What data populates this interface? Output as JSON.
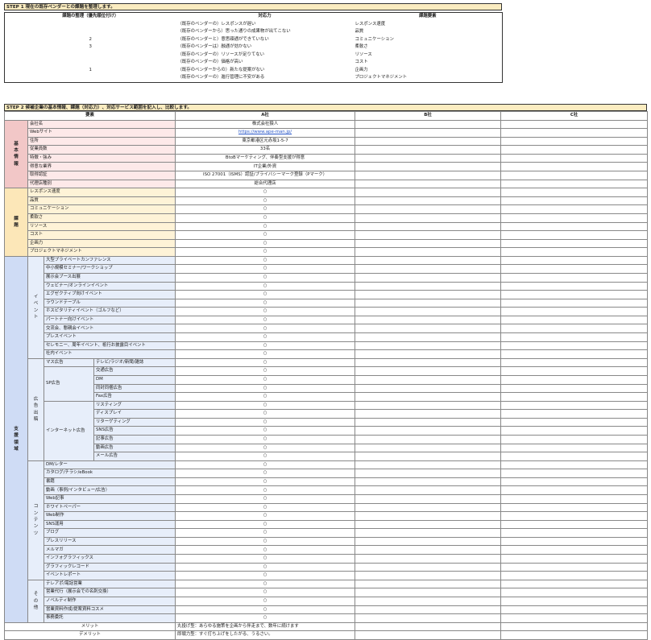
{
  "step1": {
    "title": "STEP 1  現在の既存ベンダーとの課題を整理します。",
    "headers": [
      "課題の整理（優先順位付け）",
      "対応力",
      "課題要素"
    ],
    "rows": [
      {
        "priority": "",
        "issue": "（既存のベンダーの）レスポンスが遅い",
        "element": "レスポンス速度"
      },
      {
        "priority": "",
        "issue": "（既存のベンダーから）思った通りの成果物が出てこない",
        "element": "品質"
      },
      {
        "priority": "2",
        "issue": "（既存のベンダーと）意思疎通ができていない",
        "element": "コミュニケーション"
      },
      {
        "priority": "3",
        "issue": "（既存のベンダーは）融通が効かない",
        "element": "柔軟さ"
      },
      {
        "priority": "",
        "issue": "（既存のベンダーの）リソースが足りてない",
        "element": "リソース"
      },
      {
        "priority": "",
        "issue": "（既存のベンダーの）価格が高い",
        "element": "コスト"
      },
      {
        "priority": "1",
        "issue": "（既存のベンダーからの）新たな提案がない",
        "element": "企画力"
      },
      {
        "priority": "",
        "issue": "（既存のベンダーの）進行管理に不安がある",
        "element": "プロジェクトマネジメント"
      }
    ]
  },
  "step2": {
    "title": "STEP 2  候補企業の基本情報、課題（対応力）、対応サービス範囲を記入し、比較します。",
    "headers": {
      "element": "要素",
      "a": "A社",
      "b": "B社",
      "c": "C社"
    },
    "basic": {
      "label": "基本情報",
      "rows": [
        {
          "label": "会社名",
          "a": "株式会社猿人"
        },
        {
          "label": "Webサイト",
          "a": "https://www.ape-man.jp/",
          "link": true
        },
        {
          "label": "住所",
          "a": "東京都港区元赤坂1-5-7"
        },
        {
          "label": "従業員数",
          "a": "33名"
        },
        {
          "label": "特徴・強み",
          "a": "BtoBマーケティング、伴奏型支援が得意"
        },
        {
          "label": "得意な業界",
          "a": "IT企業/外資"
        },
        {
          "label": "取得認証",
          "a": "ISO 27001（ISMS）認証/プライバシーマーク登録（Pマーク）"
        },
        {
          "label": "代理店種別",
          "a": "総合代理店"
        }
      ]
    },
    "issues": {
      "label": "課題",
      "rows": [
        {
          "label": "レスポンス速度",
          "a": "○"
        },
        {
          "label": "品質",
          "a": "○"
        },
        {
          "label": "コミュニケーション",
          "a": "○"
        },
        {
          "label": "柔軟さ",
          "a": "○"
        },
        {
          "label": "リソース",
          "a": "○"
        },
        {
          "label": "コスト",
          "a": "○"
        },
        {
          "label": "企画力",
          "a": "○"
        },
        {
          "label": "プロジェクトマネジメント",
          "a": "○"
        }
      ]
    },
    "support": {
      "label": "支援領域",
      "event": {
        "label": "イベント",
        "rows": [
          "大型プライベートカンファレンス",
          "中小規模セミナー/ワークショップ",
          "展示会ブース出展",
          "ウェビナー/オンラインイベント",
          "エグゼクティブ向けイベント",
          "ラウンドテーブル",
          "ホスピタリティイベント（ゴルフなど）",
          "パートナー向けイベント",
          "交流会、懇親会イベント",
          "プレスイベント",
          "セレモニー、周年イベント、祇行お披露目イベント",
          "社内イベント"
        ]
      },
      "ads": {
        "label": "広告出稿",
        "mass": {
          "label": "マス広告",
          "sub": "テレビ/ラジオ/新聞/雑誌"
        },
        "sp": {
          "label": "SP広告",
          "rows": [
            "交通広告",
            "DM",
            "同封同梱広告",
            "Fax広告"
          ]
        },
        "net": {
          "label": "インターネット広告",
          "rows": [
            "リスティング",
            "ディスプレイ",
            "リターゲティング",
            "SNS広告",
            "記事広告",
            "動画広告",
            "メール広告"
          ]
        }
      },
      "content": {
        "label": "コンテンツ",
        "rows": [
          "DM/レター",
          "カタログ/チラシ/eBook",
          "書籍",
          "動画（事例/インタビュー/広告）",
          "Web記事",
          "ホワイトペーパー",
          "Web制作",
          "SNS運用",
          "ブログ",
          "プレスリリース",
          "メルマガ",
          "インフォグラフィックス",
          "グラフィックレコード",
          "イベントレポート"
        ]
      },
      "other": {
        "label": "その他",
        "rows": [
          "テレアポ/電話営業",
          "営業代行（展示会での名刺交換）",
          "ノベルティ制作",
          "営業資料作成/提案資料コスメ",
          "事務委託"
        ]
      },
      "mark": "○"
    },
    "footer": [
      {
        "label": "メリット",
        "a": "丸投げ型：あらゆる施策を企画から伴走まで、数年に続けます"
      },
      {
        "label": "デメリット",
        "a": "即戦力型：すぐ打ち上げをしたがる、うるさい。"
      }
    ]
  }
}
